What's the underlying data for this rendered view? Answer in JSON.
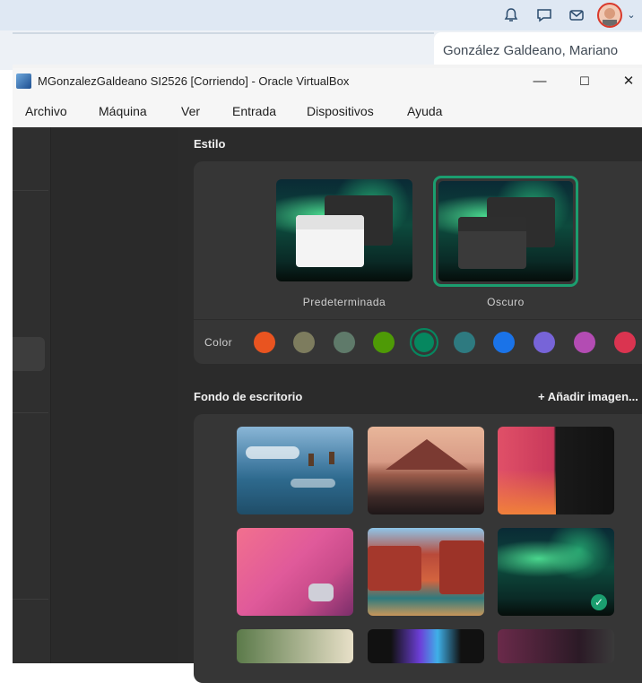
{
  "browser": {
    "user_name": "González Galdeano, Mariano",
    "icons": [
      "bell-icon",
      "chat-icon",
      "mail-icon",
      "avatar",
      "chevron-down-icon"
    ]
  },
  "window": {
    "title": "MGonzalezGaldeano SI2526 [Corriendo] - Oracle VirtualBox",
    "minimize": "—",
    "maximize": "☐",
    "close": "✕",
    "menu": [
      "Archivo",
      "Máquina",
      "Ver",
      "Entrada",
      "Dispositivos",
      "Ayuda"
    ]
  },
  "guest": {
    "style_header": "Estilo",
    "style_options": [
      "Predeterminada",
      "Oscuro"
    ],
    "selected_style": "Oscuro",
    "color_label": "Color",
    "colors": [
      "#e95420",
      "#7d7c5e",
      "#5f7a6a",
      "#4e9a06",
      "#06875f",
      "#2e7a80",
      "#1a73e8",
      "#7764d8",
      "#b34cb3",
      "#da3450"
    ],
    "selected_color": "#06875f",
    "wallpaper_header": "Fondo de escritorio",
    "add_image": "+ Añadir imagen..."
  }
}
